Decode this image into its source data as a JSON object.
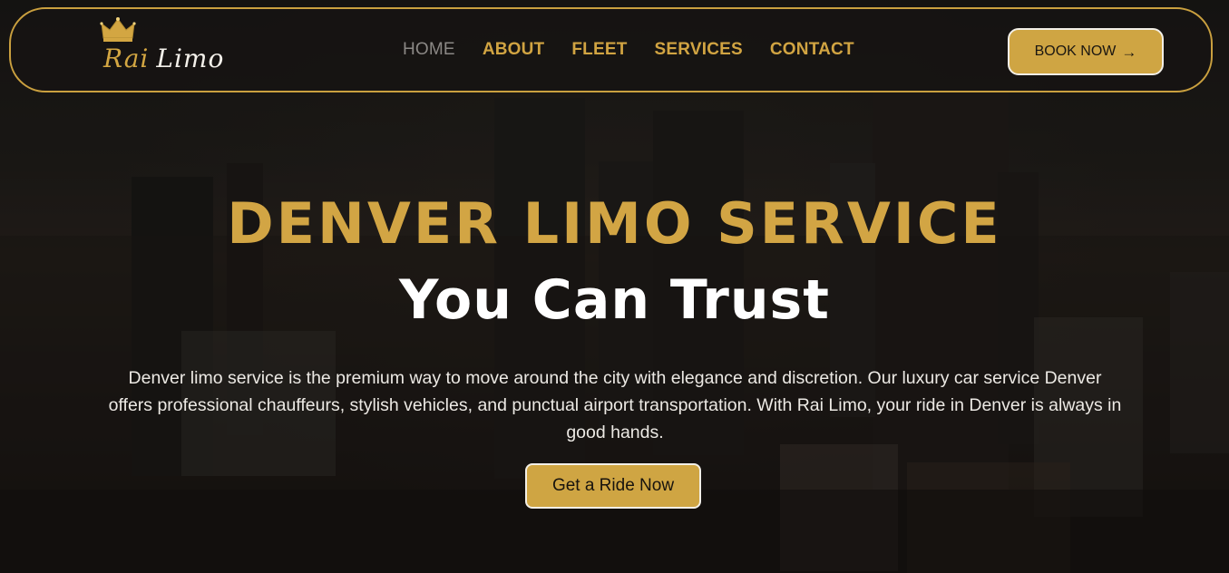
{
  "brand": {
    "name_part1": "Rai",
    "name_part2": "Limo"
  },
  "nav": {
    "items": [
      {
        "label": "HOME",
        "active": true
      },
      {
        "label": "ABOUT"
      },
      {
        "label": "FLEET"
      },
      {
        "label": "SERVICES"
      },
      {
        "label": "CONTACT"
      }
    ],
    "cta_label": "BOOK NOW"
  },
  "hero": {
    "title": "DENVER LIMO SERVICE",
    "subtitle": "You Can Trust",
    "description": "Denver limo service is the premium way to move around the city with elegance and discretion. Our luxury car service Denver offers professional chauffeurs, stylish vehicles, and punctual airport transportation. With Rai Limo, your ride in Denver is always in good hands.",
    "cta_label": "Get a Ride Now"
  },
  "colors": {
    "accent_gold": "#cfa543",
    "nav_inactive": "#8b8885",
    "text_white": "#ffffff"
  },
  "icons": {
    "book_arrow": "arrow-right-icon",
    "logo_crown": "crown-icon"
  }
}
